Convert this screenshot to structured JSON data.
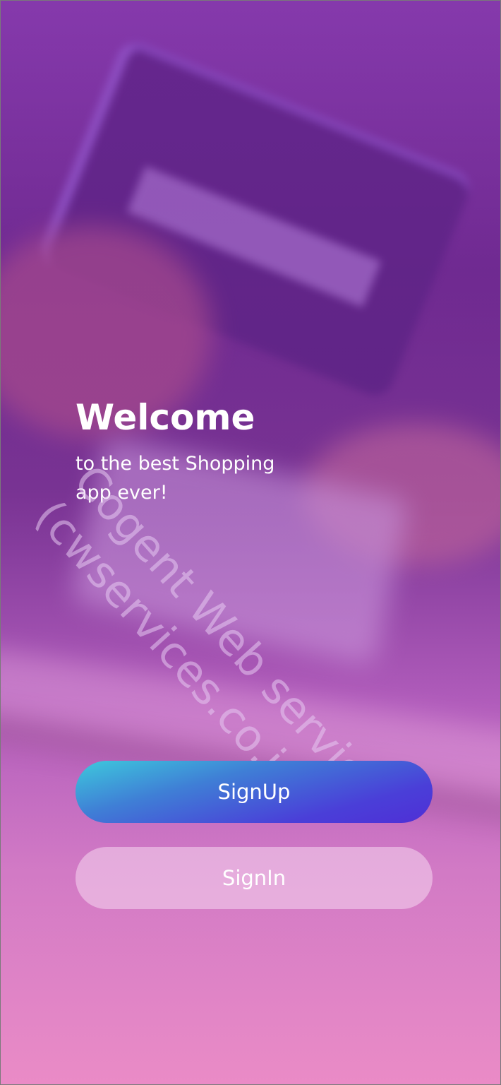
{
  "welcome": {
    "title": "Welcome",
    "subtitle": "to the best Shopping app ever!"
  },
  "actions": {
    "signup_label": "SignUp",
    "signin_label": "SignIn"
  },
  "watermark": {
    "line1": "Cogent Web services",
    "line2": "(cwservices.co.in)"
  },
  "colors": {
    "signup_gradient_start": "#3ec9dc",
    "signup_gradient_end": "#4f2fd6",
    "background_top": "#8a3fb0",
    "background_bottom": "#e88bc6",
    "text": "#ffffff"
  }
}
